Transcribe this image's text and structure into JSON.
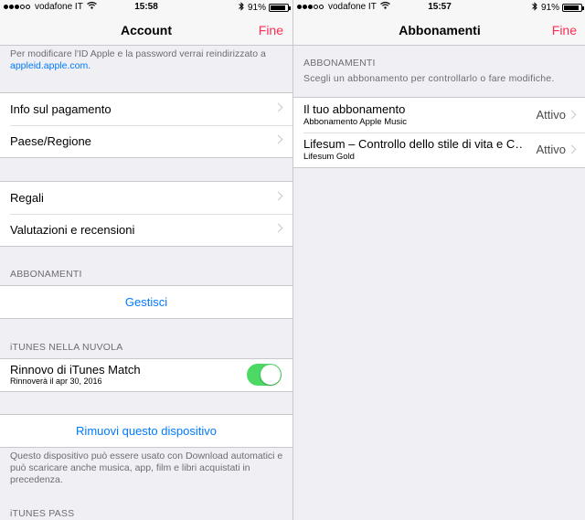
{
  "left": {
    "status": {
      "carrier": "vodafone IT",
      "time": "15:58",
      "battery": "91%"
    },
    "nav": {
      "title": "Account",
      "done": "Fine"
    },
    "intro": {
      "text": "Per modificare l'ID Apple e la password verrai reindirizzato a",
      "link": "appleid.apple.com."
    },
    "group1": [
      "Info sul pagamento",
      "Paese/Regione"
    ],
    "group2": [
      "Regali",
      "Valutazioni e recensioni"
    ],
    "subscriptions": {
      "header": "ABBONAMENTI",
      "button": "Gestisci"
    },
    "cloud": {
      "header": "iTUNES NELLA NUVOLA",
      "label": "Rinnovo di iTunes Match",
      "sublabel": "Rinnoverà il apr 30, 2016",
      "toggle_on": true
    },
    "device": {
      "button": "Rimuovi questo dispositivo",
      "footer": "Questo dispositivo può essere usato con Download automatici e può scaricare anche musica, app, film e libri acquistati in precedenza."
    },
    "pass": {
      "header": "iTUNES PASS"
    }
  },
  "right": {
    "status": {
      "carrier": "vodafone IT",
      "time": "15:57",
      "battery": "91%"
    },
    "nav": {
      "title": "Abbonamenti",
      "done": "Fine"
    },
    "header": "ABBONAMENTI",
    "subheader": "Scegli un abbonamento per controllarlo o fare modifiche.",
    "items": [
      {
        "title": "Il tuo abbonamento",
        "subtitle": "Abbonamento Apple Music",
        "status": "Attivo"
      },
      {
        "title": "Lifesum – Controllo dello stile di vita e C…",
        "subtitle": "Lifesum Gold",
        "status": "Attivo"
      }
    ]
  },
  "colors": {
    "accent": "#007aff",
    "done": "#ff2d55",
    "toggle": "#4cd964",
    "background": "#efeff4"
  }
}
